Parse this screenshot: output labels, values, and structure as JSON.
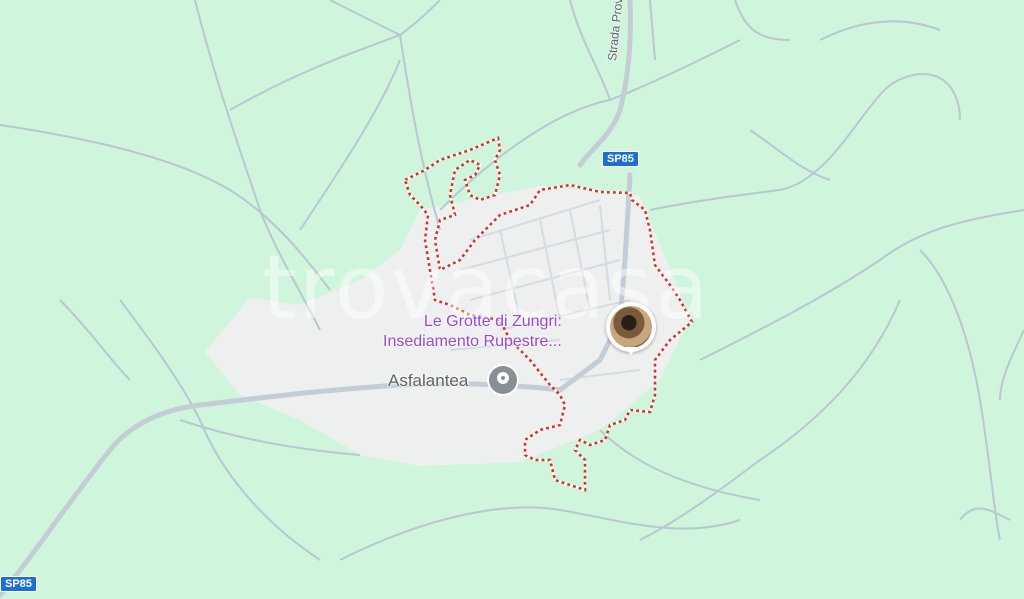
{
  "map": {
    "colors": {
      "land": "#cff5dc",
      "urban": "#eef0f0",
      "road": "#c2cdd6",
      "boundary": "#d93025",
      "poi_purple": "#9b46d6",
      "shield": "#1f6fd1"
    },
    "watermark": "trovacasa",
    "road_name": "Strada Provinciale",
    "shields": {
      "top": "SP85",
      "bottom_left": "SP85"
    },
    "places": {
      "attraction_line1": "Le Grotte di Zungri:",
      "attraction_line2": "Insediamento Rupestre...",
      "attraction_icon": "photo-thumbnail",
      "business": "Asfalantea",
      "business_icon": "place-pin-icon"
    }
  }
}
